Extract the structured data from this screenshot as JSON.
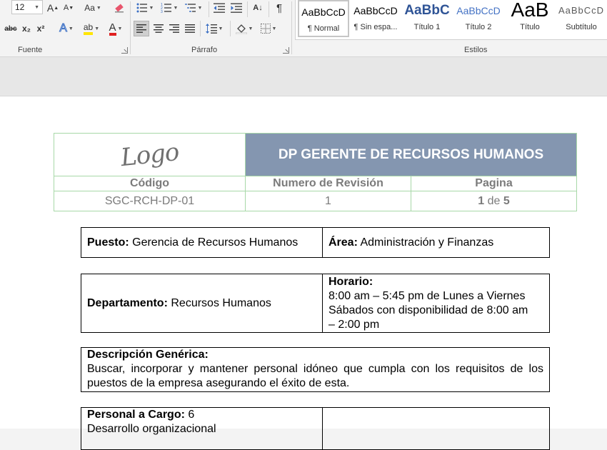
{
  "ribbon": {
    "font_size": "12",
    "groups": {
      "fuente": "Fuente",
      "parrafo": "Párrafo",
      "estilos": "Estilos"
    },
    "buttons": {
      "grow": "A",
      "shrink": "A",
      "case": "Aa",
      "strike": "abc",
      "sub": "x₂",
      "sup": "x²",
      "effects": "A",
      "highlight": "ab",
      "fontcolor": "A",
      "pilcrow": "¶",
      "sort": "A↓"
    },
    "styles": [
      {
        "preview": "AaBbCcD",
        "name": "¶ Normal"
      },
      {
        "preview": "AaBbCcD",
        "name": "¶ Sin espa..."
      },
      {
        "preview": "AaBbC",
        "name": "Título 1"
      },
      {
        "preview": "AaBbCcD",
        "name": "Título 2"
      },
      {
        "preview": "AaB",
        "name": "Título"
      },
      {
        "preview": "AaBbCcD",
        "name": "Subtítulo"
      }
    ]
  },
  "header": {
    "logo": "Logo",
    "title": "DP GERENTE DE RECURSOS HUMANOS",
    "col_codigo": "Código",
    "col_revision": "Numero de Revisión",
    "col_pagina": "Pagina",
    "codigo": "SGC-RCH-DP-01",
    "revision": "1",
    "page_current": "1",
    "page_of": "de",
    "page_total": "5"
  },
  "fields": {
    "puesto_label": "Puesto:",
    "puesto_value": "Gerencia de Recursos Humanos",
    "area_label": "Área:",
    "area_value": "Administración y Finanzas",
    "departamento_label": "Departamento:",
    "departamento_value": "Recursos Humanos",
    "horario_label": "Horario:",
    "horario_value": "8:00 am – 5:45 pm de Lunes a Viernes Sábados con disponibilidad de 8:00 am – 2:00 pm",
    "descripcion_label": "Descripción Genérica:",
    "descripcion_value": "Buscar, incorporar y mantener personal idóneo que cumpla con los requisitos de los puestos de la empresa asegurando el éxito de esta.",
    "personal_label": "Personal a Cargo:",
    "personal_value": "6",
    "personal_item": "Desarrollo organizacional"
  },
  "colors": {
    "title_bg": "#8496b0",
    "header_border": "#a8d8a8",
    "header_text": "#7b7b7b"
  }
}
